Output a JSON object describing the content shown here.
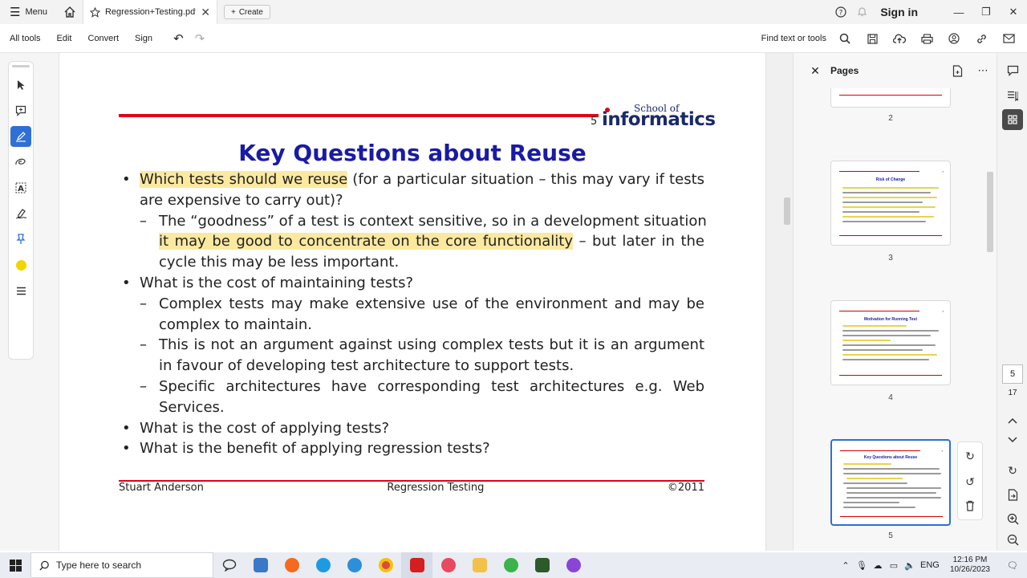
{
  "titlebar": {
    "menu_label": "Menu",
    "tab_title": "Regression+Testing.pdf",
    "create_label": "Create",
    "signin_label": "Sign in"
  },
  "toolbar": {
    "items": [
      "All tools",
      "Edit",
      "Convert",
      "Sign"
    ],
    "find_label": "Find text or tools"
  },
  "slide": {
    "page_number": "5",
    "logo_small": "School of",
    "logo_big": "informatics",
    "title": "Key Questions about Reuse",
    "b1_hl": "Which tests should we reuse",
    "b1_rest": " (for a particular situation – this may vary if tests",
    "b1_line2": "are expensive to carry out)?",
    "s1_line1": "The “goodness” of a test is context sensitive, so in a development situation",
    "s1_hl": "it may be good to concentrate on the core functionality",
    "s1_rest": " – but later in the",
    "s1_line3": "cycle this may be less important.",
    "b2": "What is the cost of maintaining tests?",
    "s2_line1": "Complex tests may make extensive use of the environment and may be",
    "s2_line2": "complex to maintain.",
    "s3_line1": "This is not an argument against using complex tests but it is an argument",
    "s3_line2": "in favour of developing test architecture to support tests.",
    "s4_line1": "Specific architectures have corresponding test architectures e.g.  Web",
    "s4_line2": "Services.",
    "b3": "What is the cost of applying tests?",
    "b4": "What is the benefit of applying regression tests?",
    "footer_left": "Stuart Anderson",
    "footer_center": "Regression Testing",
    "footer_right": "©2011"
  },
  "pages_panel": {
    "title": "Pages",
    "thumbnails": [
      {
        "label": "2",
        "title": ""
      },
      {
        "label": "3",
        "title": "Risk of Change"
      },
      {
        "label": "4",
        "title": "Motivation for Running Test"
      },
      {
        "label": "5",
        "title": "Key Questions about Reuse"
      }
    ]
  },
  "right_rail": {
    "current_page": "5",
    "total_pages": "17"
  },
  "taskbar": {
    "search_placeholder": "Type here to search",
    "lang": "ENG",
    "time": "12:16 PM",
    "date": "10/26/2023"
  },
  "colors": {
    "accent": "#2f6fd6",
    "slide_title": "#1a1aa6",
    "rule_red": "#e0001b",
    "highlight": "#fbe9a0"
  }
}
